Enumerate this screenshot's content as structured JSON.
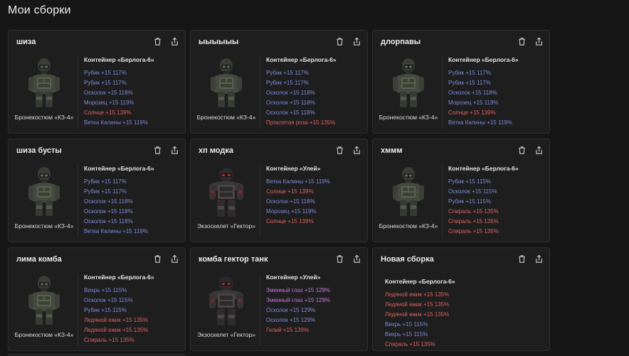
{
  "page": {
    "title": "Мои сборки"
  },
  "colors": {
    "blue": "#7f89d8",
    "red": "#e06060",
    "pink": "#c27ad8",
    "bg": "#161616",
    "card": "#1e1e1e"
  },
  "icons": {
    "delete": "trash-icon",
    "share": "share-icon"
  },
  "cards": [
    {
      "title": "шиза",
      "armor": "Бронекостюм «КЗ-4»",
      "armor_type": "kz4",
      "container": "Контейнер «Берлога-6»",
      "stats": [
        {
          "text": "Рубик +15 117%",
          "color": "blue"
        },
        {
          "text": "Рубик +15 117%",
          "color": "blue"
        },
        {
          "text": "Осколок +15 118%",
          "color": "blue"
        },
        {
          "text": "Морозец +15 119%",
          "color": "blue"
        },
        {
          "text": "Солнце +15 139%",
          "color": "red"
        },
        {
          "text": "Ветка Калины +15 119%",
          "color": "blue"
        }
      ]
    },
    {
      "title": "ыыыыыы",
      "armor": "Бронекостюм «КЗ-4»",
      "armor_type": "kz4",
      "container": "Контейнер «Берлога-6»",
      "stats": [
        {
          "text": "Рубик +15 117%",
          "color": "blue"
        },
        {
          "text": "Рубик +15 117%",
          "color": "blue"
        },
        {
          "text": "Осколок +15 118%",
          "color": "blue"
        },
        {
          "text": "Осколок +15 118%",
          "color": "blue"
        },
        {
          "text": "Осколок +15 118%",
          "color": "blue"
        },
        {
          "text": "Проклятая роза +15 135%",
          "color": "red"
        }
      ]
    },
    {
      "title": "длорпавы",
      "armor": "Бронекостюм «КЗ-4»",
      "armor_type": "kz4",
      "container": "Контейнер «Берлога-6»",
      "stats": [
        {
          "text": "Рубик +15 117%",
          "color": "blue"
        },
        {
          "text": "Рубик +15 117%",
          "color": "blue"
        },
        {
          "text": "Осколок +15 118%",
          "color": "blue"
        },
        {
          "text": "Морозец +15 119%",
          "color": "blue"
        },
        {
          "text": "Солнце +15 139%",
          "color": "red"
        },
        {
          "text": "Ветка Калины +15 119%",
          "color": "blue"
        }
      ]
    },
    {
      "title": "шиза бусты",
      "armor": "Бронекостюм «КЗ-4»",
      "armor_type": "kz4",
      "container": "Контейнер «Берлога-6»",
      "stats": [
        {
          "text": "Рубик +15 117%",
          "color": "blue"
        },
        {
          "text": "Рубик +15 117%",
          "color": "blue"
        },
        {
          "text": "Осколок +15 118%",
          "color": "blue"
        },
        {
          "text": "Осколок +15 118%",
          "color": "blue"
        },
        {
          "text": "Осколок +15 118%",
          "color": "blue"
        },
        {
          "text": "Ветка Калины +15 119%",
          "color": "blue"
        }
      ]
    },
    {
      "title": "хп модка",
      "armor": "Экзоскелет «Гектор»",
      "armor_type": "hector",
      "container": "Контейнер «Улей»",
      "stats": [
        {
          "text": "Ветка Калины +15 119%",
          "color": "blue"
        },
        {
          "text": "Солнце +15 139%",
          "color": "red"
        },
        {
          "text": "Осколок +15 118%",
          "color": "blue"
        },
        {
          "text": "Морозец +15 119%",
          "color": "blue"
        },
        {
          "text": "Солнце +15 139%",
          "color": "red"
        }
      ]
    },
    {
      "title": "хммм",
      "armor": "Бронекостюм «КЗ-4»",
      "armor_type": "kz4",
      "container": "Контейнер «Берлога-6»",
      "stats": [
        {
          "text": "Рубик +15 115%",
          "color": "blue"
        },
        {
          "text": "Осколок +15 115%",
          "color": "blue"
        },
        {
          "text": "Рубик +15 115%",
          "color": "blue"
        },
        {
          "text": "Спираль +15 135%",
          "color": "red"
        },
        {
          "text": "Спираль +15 135%",
          "color": "red"
        },
        {
          "text": "Спираль +15 135%",
          "color": "red"
        }
      ]
    },
    {
      "title": "лима комба",
      "armor": "Бронекостюм «КЗ-4»",
      "armor_type": "kz4",
      "container": "Контейнер «Берлога-6»",
      "stats": [
        {
          "text": "Вихрь +15 115%",
          "color": "blue"
        },
        {
          "text": "Осколок +15 115%",
          "color": "blue"
        },
        {
          "text": "Рубик +15 115%",
          "color": "blue"
        },
        {
          "text": "Ледяной ежик +15 135%",
          "color": "red"
        },
        {
          "text": "Ледяной ежик +15 135%",
          "color": "red"
        },
        {
          "text": "Спираль +15 135%",
          "color": "red"
        }
      ]
    },
    {
      "title": "комба гектор танк",
      "armor": "Экзоскелет «Гектор»",
      "armor_type": "hector",
      "container": "Контейнер «Улей»",
      "stats": [
        {
          "text": "Змеиный глаз +15 129%",
          "color": "pink"
        },
        {
          "text": "Змеиный глаз +15 129%",
          "color": "pink"
        },
        {
          "text": "Осколок +15 129%",
          "color": "blue"
        },
        {
          "text": "Осколок +15 129%",
          "color": "blue"
        },
        {
          "text": "Гелий +15 139%",
          "color": "red"
        }
      ]
    },
    {
      "title": "Новая сборка",
      "armor": "",
      "armor_type": "none",
      "container": "Контейнер «Берлога-6»",
      "stats": [
        {
          "text": "Ледяной ежик +15 135%",
          "color": "red"
        },
        {
          "text": "Ледяной ежик +15 135%",
          "color": "red"
        },
        {
          "text": "Ледяной ежик +15 135%",
          "color": "red"
        },
        {
          "text": "Вихрь +15 115%",
          "color": "blue"
        },
        {
          "text": "Вихрь +15 115%",
          "color": "blue"
        },
        {
          "text": "Спираль +15 135%",
          "color": "red"
        }
      ]
    }
  ]
}
